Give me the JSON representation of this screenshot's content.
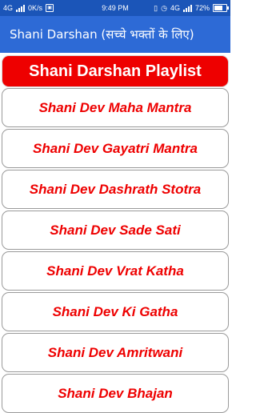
{
  "status_bar": {
    "network_left": "4G",
    "speed": "0K/s",
    "time": "9:49 PM",
    "network_right": "4G",
    "battery": "72%"
  },
  "app_bar": {
    "title": "Shani Darshan (सच्चे भक्तों के लिए)"
  },
  "header": {
    "label": "Shani Darshan Playlist"
  },
  "items": [
    {
      "label": "Shani Dev Maha Mantra"
    },
    {
      "label": "Shani Dev Gayatri Mantra"
    },
    {
      "label": "Shani Dev Dashrath Stotra"
    },
    {
      "label": "Shani Dev Sade Sati"
    },
    {
      "label": "Shani Dev Vrat Katha"
    },
    {
      "label": "Shani Dev Ki Gatha"
    },
    {
      "label": "Shani Dev Amritwani"
    },
    {
      "label": "Shani Dev Bhajan"
    }
  ],
  "colors": {
    "status_bar": "#1b55b8",
    "app_bar": "#2d6ad6",
    "accent_red": "#ee0000"
  }
}
